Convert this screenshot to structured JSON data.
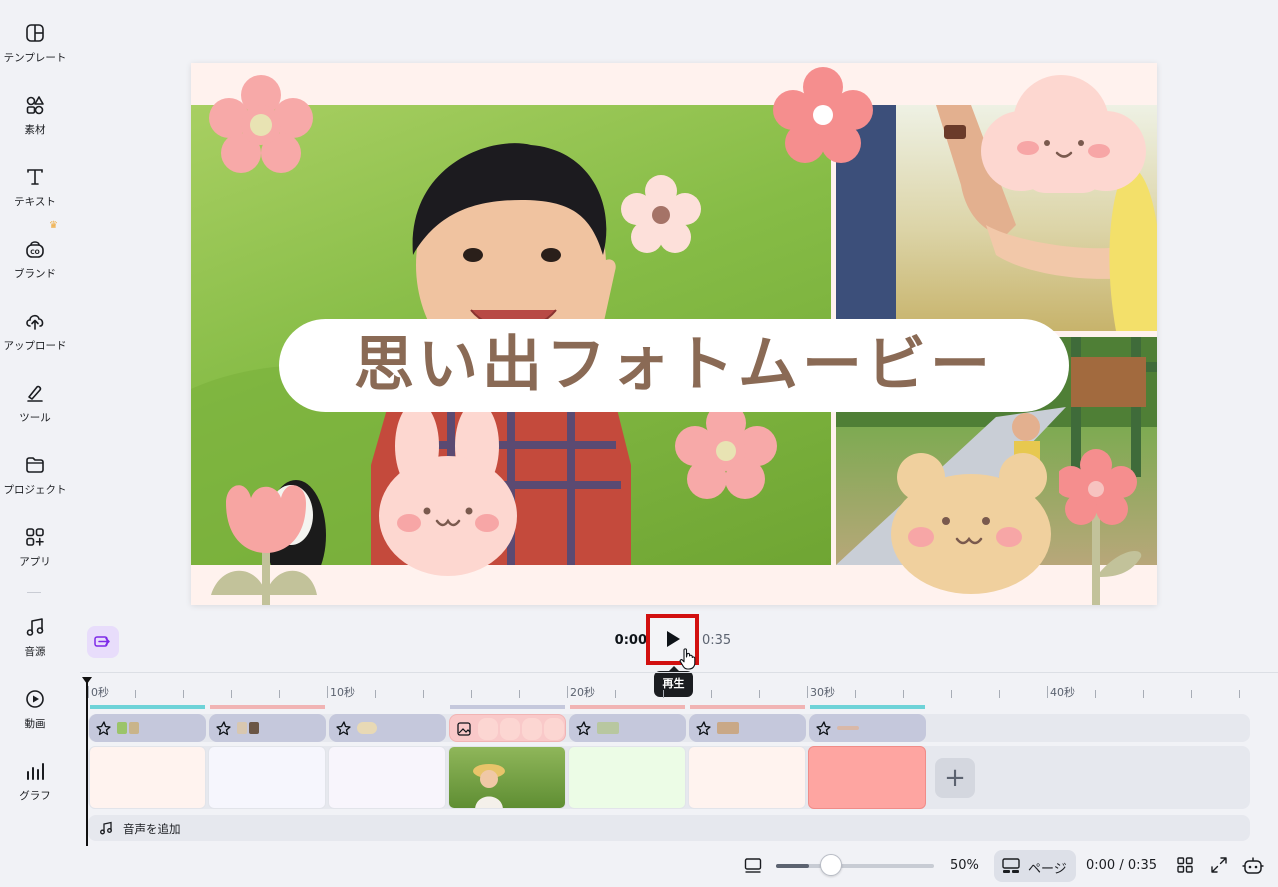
{
  "sidebar": {
    "items": [
      {
        "label": "テンプレート",
        "icon": "template-icon"
      },
      {
        "label": "素材",
        "icon": "elements-icon"
      },
      {
        "label": "テキスト",
        "icon": "text-icon"
      },
      {
        "label": "ブランド",
        "icon": "brand-icon",
        "badge": "crown-icon"
      },
      {
        "label": "アップロード",
        "icon": "upload-icon"
      },
      {
        "label": "ツール",
        "icon": "tools-icon"
      },
      {
        "label": "プロジェクト",
        "icon": "folder-icon"
      },
      {
        "label": "アプリ",
        "icon": "apps-icon"
      },
      {
        "label": "音源",
        "icon": "music-icon"
      },
      {
        "label": "動画",
        "icon": "video-icon"
      },
      {
        "label": "グラフ",
        "icon": "chart-icon"
      }
    ]
  },
  "canvas": {
    "title": "思い出フォトムービー",
    "background": "#fff2ee"
  },
  "playback": {
    "current_time": "0:00",
    "total_time": "0:35",
    "tooltip": "再生",
    "play_icon": "play-icon"
  },
  "timeline": {
    "ruler_labels": [
      "0秒",
      "10秒",
      "20秒",
      "30秒",
      "40秒"
    ],
    "audio_label": "音声を追加",
    "page_colors": [
      "#fff3ef",
      "#f6f6fd",
      "#f8f5fc",
      "photo",
      "#ecfce6",
      "#fff3ef",
      "#fea5a1"
    ]
  },
  "bottom_bar": {
    "zoom_percent": 50,
    "zoom_label": "50%",
    "pages_label": "ページ",
    "time_label": "0:00 / 0:35"
  },
  "colors": {
    "accent_red": "#d21010",
    "title_brown": "#8a6a55",
    "flower_pink": "#f7a5a2"
  }
}
